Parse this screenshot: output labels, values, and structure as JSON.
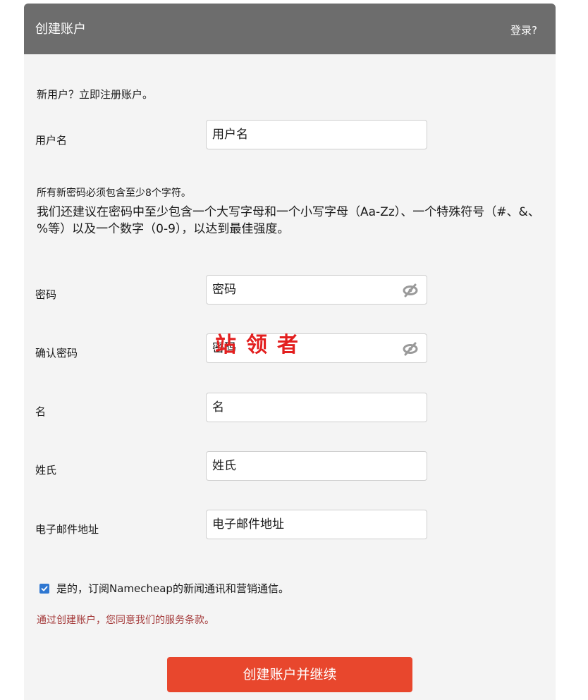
{
  "header": {
    "title": "创建账户",
    "login_link": "登录?"
  },
  "intro": "新用户？立即注册账户。",
  "fields": {
    "username": {
      "label": "用户名",
      "placeholder": "用户名"
    },
    "password": {
      "label": "密码",
      "placeholder": "密码"
    },
    "confirm_password": {
      "label": "确认密码",
      "placeholder": "密码"
    },
    "first_name": {
      "label": "名",
      "placeholder": "名"
    },
    "last_name": {
      "label": "姓氏",
      "placeholder": "姓氏"
    },
    "email": {
      "label": "电子邮件地址",
      "placeholder": "电子邮件地址"
    }
  },
  "password_hint": {
    "requirement": "所有新密码必须包含至少8个字符。",
    "recommendation": "我们还建议在密码中至少包含一个大写字母和一个小写字母（Aa-Zz）、一个特殊符号（#、&、%等）以及一个数字（0-9），以达到最佳强度。"
  },
  "stamp_text": "站领者",
  "newsletter": {
    "checked": true,
    "label": "是的，订阅Namecheap的新闻通讯和营销通信。"
  },
  "terms_text": "通过创建账户，您同意我们的服务条款。",
  "submit_label": "创建账户并继续",
  "colors": {
    "header_bg": "#6d6d6d",
    "submit_bg": "#e8472d",
    "checkbox": "#2f77d1",
    "terms": "#a43a3a",
    "stamp": "#e31f1f"
  },
  "icons": {
    "password_toggle": "eye-slash-icon",
    "checkbox": "check-icon"
  }
}
